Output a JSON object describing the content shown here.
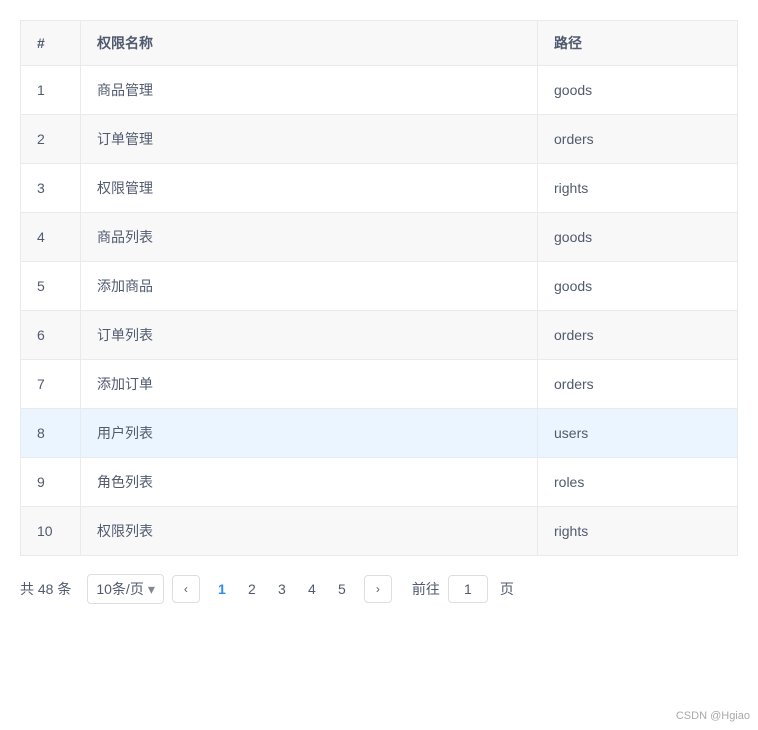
{
  "table": {
    "columns": [
      {
        "key": "num",
        "label": "#"
      },
      {
        "key": "name",
        "label": "权限名称"
      },
      {
        "key": "path",
        "label": "路径"
      }
    ],
    "rows": [
      {
        "num": 1,
        "name": "商品管理",
        "path": "goods",
        "highlighted": false
      },
      {
        "num": 2,
        "name": "订单管理",
        "path": "orders",
        "highlighted": false
      },
      {
        "num": 3,
        "name": "权限管理",
        "path": "rights",
        "highlighted": false
      },
      {
        "num": 4,
        "name": "商品列表",
        "path": "goods",
        "highlighted": false
      },
      {
        "num": 5,
        "name": "添加商品",
        "path": "goods",
        "highlighted": false
      },
      {
        "num": 6,
        "name": "订单列表",
        "path": "orders",
        "highlighted": false
      },
      {
        "num": 7,
        "name": "添加订单",
        "path": "orders",
        "highlighted": false
      },
      {
        "num": 8,
        "name": "用户列表",
        "path": "users",
        "highlighted": true
      },
      {
        "num": 9,
        "name": "角色列表",
        "path": "roles",
        "highlighted": false
      },
      {
        "num": 10,
        "name": "权限列表",
        "path": "rights",
        "highlighted": false
      }
    ]
  },
  "pagination": {
    "total_text": "共 48 条",
    "page_size_label": "10条/页",
    "prev_label": "‹",
    "next_label": "›",
    "pages": [
      1,
      2,
      3,
      4,
      5
    ],
    "current_page": 1,
    "goto_prefix": "前往",
    "goto_value": "1",
    "goto_suffix": "页"
  },
  "watermark": "CSDN @Hgiao"
}
